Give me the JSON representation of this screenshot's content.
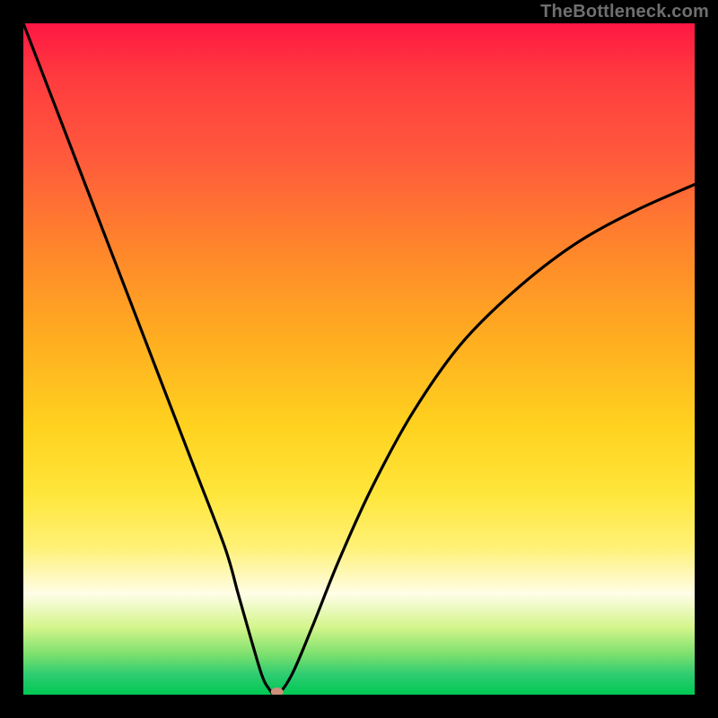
{
  "watermark": "TheBottleneck.com",
  "chart_data": {
    "type": "line",
    "title": "",
    "xlabel": "",
    "ylabel": "",
    "xlim": [
      0,
      100
    ],
    "ylim": [
      0,
      100
    ],
    "series": [
      {
        "name": "bottleneck-curve",
        "x": [
          0,
          5,
          10,
          15,
          20,
          25,
          30,
          32,
          34,
          35.5,
          36.5,
          37.8,
          40,
          43,
          47,
          52,
          58,
          65,
          73,
          82,
          91,
          100
        ],
        "values": [
          100,
          87,
          74,
          61,
          48,
          35,
          22,
          15,
          8,
          3,
          1,
          0,
          3,
          10,
          20,
          31,
          42,
          52,
          60,
          67,
          72,
          76
        ]
      }
    ],
    "marker": {
      "x": 37.8,
      "y": 0
    },
    "legend": false,
    "grid": false
  }
}
